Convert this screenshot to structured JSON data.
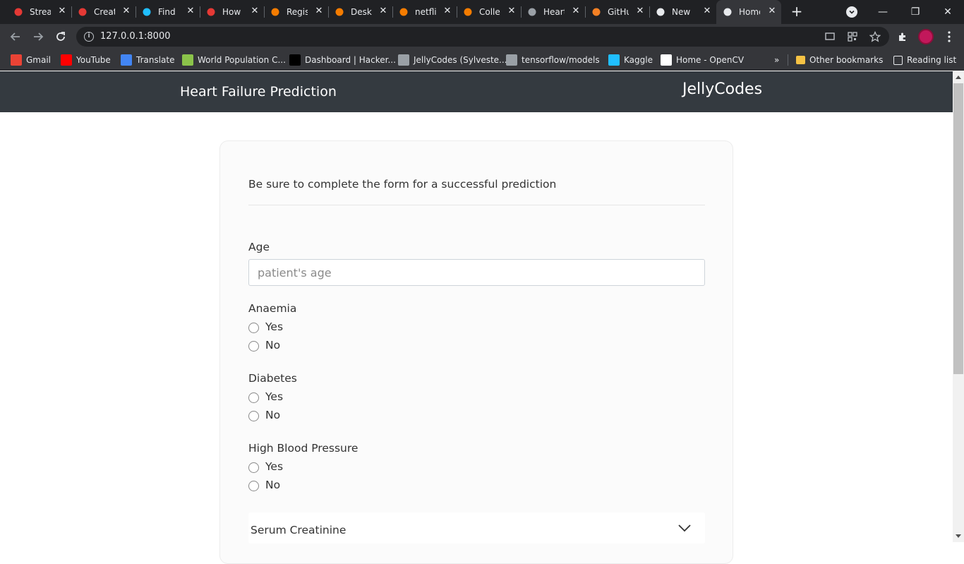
{
  "browser": {
    "tabs": [
      {
        "title": "Stream",
        "icon": "crown-icon",
        "color": "#e53935"
      },
      {
        "title": "Create",
        "icon": "crown-icon",
        "color": "#e53935"
      },
      {
        "title": "Find",
        "icon": "kaggle-icon",
        "color": "#20beff"
      },
      {
        "title": "How",
        "icon": "triangle-icon",
        "color": "#e53935"
      },
      {
        "title": "Register",
        "icon": "cube-icon",
        "color": "#f57c00"
      },
      {
        "title": "Desktop",
        "icon": "arc-icon",
        "color": "#f57c00"
      },
      {
        "title": "netflix",
        "icon": "notebook-icon",
        "color": "#f57c00"
      },
      {
        "title": "Colle",
        "icon": "notebook-icon",
        "color": "#f57c00"
      },
      {
        "title": "Heart",
        "icon": "github-icon",
        "color": "#9aa0a6"
      },
      {
        "title": "GitHub",
        "icon": "stack-icon",
        "color": "#f48024"
      },
      {
        "title": "New",
        "icon": "chrome-icon",
        "color": "#e8eaed"
      },
      {
        "title": "Home",
        "icon": "globe-icon",
        "color": "#e8eaed"
      }
    ],
    "url": "127.0.0.1:8000",
    "bookmarks": [
      {
        "label": "Gmail",
        "icon": "gmail-icon",
        "color": "#ea4335"
      },
      {
        "label": "YouTube",
        "icon": "youtube-icon",
        "color": "#ff0000"
      },
      {
        "label": "Translate",
        "icon": "translate-icon",
        "color": "#4285f4"
      },
      {
        "label": "World Population C...",
        "icon": "world-population-icon",
        "color": "#8bc34a"
      },
      {
        "label": "Dashboard | Hacker...",
        "icon": "hackerrank-icon",
        "color": "#000000"
      },
      {
        "label": "JellyCodes (Sylveste...",
        "icon": "github-icon",
        "color": "#9aa0a6"
      },
      {
        "label": "tensorflow/models",
        "icon": "github-icon",
        "color": "#9aa0a6"
      },
      {
        "label": "Kaggle",
        "icon": "kaggle-icon",
        "color": "#20beff"
      },
      {
        "label": "Home - OpenCV",
        "icon": "opencv-icon",
        "color": "#ffffff"
      }
    ],
    "overflow": "»",
    "other_bookmarks": "Other bookmarks",
    "reading_list": "Reading list"
  },
  "page": {
    "brand_left": "Heart Failure Prediction",
    "brand_right": "JellyCodes",
    "note": "Be sure to complete the form for a successful prediction",
    "age": {
      "label": "Age",
      "placeholder": "patient's age"
    },
    "anaemia": {
      "label": "Anaemia",
      "yes": "Yes",
      "no": "No"
    },
    "diabetes": {
      "label": "Diabetes",
      "yes": "Yes",
      "no": "No"
    },
    "high_bp": {
      "label": "High Blood Pressure",
      "yes": "Yes",
      "no": "No"
    },
    "serum_creatinine": {
      "label": "Serum Creatinine"
    }
  }
}
